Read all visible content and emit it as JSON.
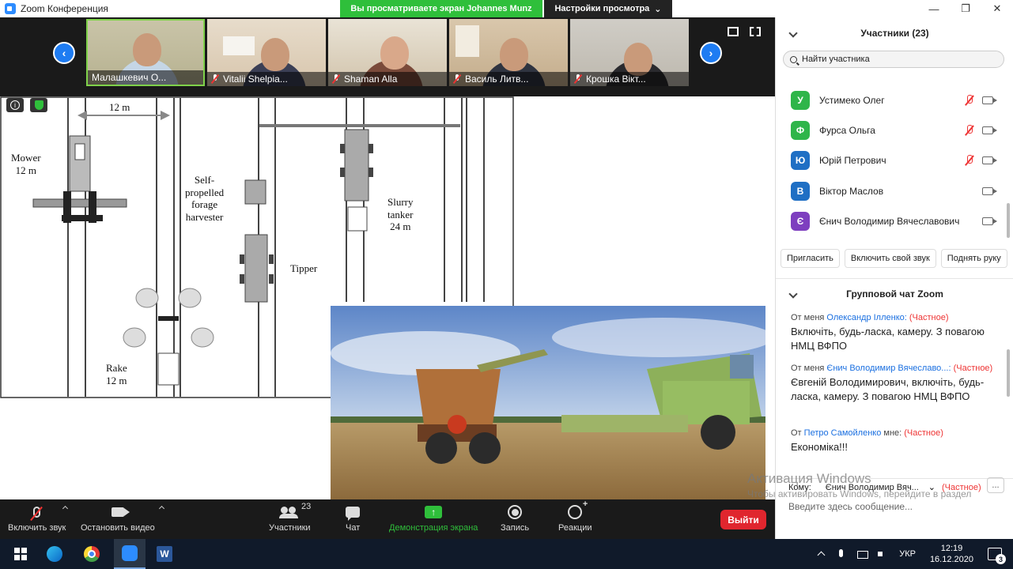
{
  "window": {
    "title": "Zoom Конференция",
    "viewing_banner": "Вы просматриваете экран Johannes Munz",
    "view_options": "Настройки просмотра"
  },
  "thumbnails": [
    {
      "name": "Малашкевич О...",
      "muted": false,
      "active": true
    },
    {
      "name": "Vitalii Shelpia...",
      "muted": true,
      "active": false
    },
    {
      "name": "Shaman Alla",
      "muted": true,
      "active": false
    },
    {
      "name": "Василь Литв...",
      "muted": true,
      "active": false
    },
    {
      "name": "Крошка Вікт...",
      "muted": true,
      "active": false
    }
  ],
  "diagram": {
    "width_label": "12 m",
    "mower": "Mower\n12 m",
    "harvester": "Self-\npropelled\nforage\nharvester",
    "slurry": "Slurry\ntanker\n24 m",
    "tipper": "Tipper",
    "rake": "Rake\n12 m"
  },
  "participants_panel": {
    "title": "Участники (23)",
    "search_placeholder": "Найти участника",
    "participants": [
      {
        "initial": "У",
        "name": "Устимеко Олег",
        "color": "#2fb54a",
        "muted": true
      },
      {
        "initial": "Ф",
        "name": "Фурса Ольга",
        "color": "#2fb54a",
        "muted": true
      },
      {
        "initial": "Ю",
        "name": "Юрій Петрович",
        "color": "#1f6fc4",
        "muted": true
      },
      {
        "initial": "В",
        "name": "Віктор Маслов",
        "color": "#1f6fc4",
        "muted": false
      },
      {
        "initial": "Є",
        "name": "Єнич Володимир Вячеславович",
        "color": "#7e3fbf",
        "muted": false
      }
    ],
    "actions": {
      "invite": "Пригласить",
      "unmute": "Включить свой звук",
      "raise_hand": "Поднять руку"
    }
  },
  "chat": {
    "title": "Групповой чат Zoom",
    "messages": [
      {
        "prefix": "От меня ",
        "to": "Олександр Ілленко:",
        "private": "(Частное)",
        "text": "Включіть, будь-ласка, камеру. З повагою НМЦ ВФПО"
      },
      {
        "prefix": "От меня ",
        "to": "Єнич Володимир Вячеславо...:",
        "private": "(Частное)",
        "text": "Євгеній Володимирович, включіть, будь-ласка, камеру. З повагою НМЦ ВФПО"
      },
      {
        "prefix": "От ",
        "to": "Петро Самойленко",
        "suffix": " мне:",
        "private": "(Частное)",
        "text": "Економіка!!!"
      }
    ],
    "to_label": "Кому:",
    "to_value": "Єнич Володимир Вяч...",
    "to_private": "(Частное)",
    "more_label": "...",
    "input_placeholder": "Введите здесь сообщение..."
  },
  "watermark": {
    "line1": "Активация Windows",
    "line2": "Чтобы активировать Windows, перейдите в раздел"
  },
  "toolbar": {
    "unmute": "Включить звук",
    "stop_video": "Остановить видео",
    "participants": "Участники",
    "participants_count": "23",
    "chat": "Чат",
    "share": "Демонстрация экрана",
    "record": "Запись",
    "reactions": "Реакции",
    "end": "Выйти"
  },
  "taskbar": {
    "word_label": "W",
    "lang": "УКР",
    "time": "12:19",
    "date": "16.12.2020",
    "notif_count": "3"
  },
  "colors": {
    "zoom_blue": "#2d8cff",
    "banner_green": "#2fbf3b",
    "end_red": "#e0262e",
    "private_red": "#e33333",
    "chat_blue": "#1a6fe0"
  }
}
